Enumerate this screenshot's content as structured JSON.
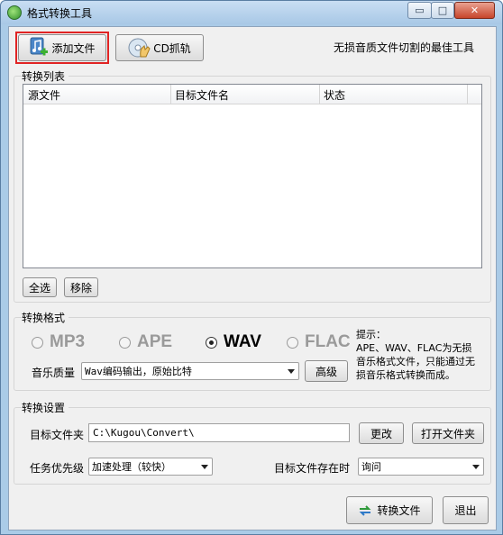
{
  "window": {
    "title": "格式转换工具",
    "controls": {
      "minimize": "▭",
      "maximize": "□",
      "close": "✕"
    }
  },
  "toolbar": {
    "add_file_label": "添加文件",
    "cd_rip_label": "CD抓轨",
    "tagline": "无损音质文件切割的最佳工具"
  },
  "convert_list": {
    "group_label": "转换列表",
    "columns": [
      "源文件",
      "目标文件名",
      "状态"
    ],
    "rows": [],
    "select_all_label": "全选",
    "remove_label": "移除"
  },
  "format": {
    "group_label": "转换格式",
    "options": [
      {
        "label": "MP3",
        "selected": false
      },
      {
        "label": "APE",
        "selected": false
      },
      {
        "label": "WAV",
        "selected": true
      },
      {
        "label": "FLAC",
        "selected": false
      }
    ],
    "quality_label": "音乐质量",
    "quality_value": "Wav编码输出，原始比特",
    "advanced_label": "高级",
    "hint_title": "提示：",
    "hint_text": "APE、WAV、FLAC为无损\n音乐格式文件，只能通过无\n损音乐格式转换而成。"
  },
  "settings": {
    "group_label": "转换设置",
    "target_folder_label": "目标文件夹",
    "target_folder_value": "C:\\Kugou\\Convert\\",
    "change_label": "更改",
    "open_folder_label": "打开文件夹",
    "priority_label": "任务优先级",
    "priority_value": "加速处理（较快）",
    "exists_label": "目标文件存在时",
    "exists_value": "询问"
  },
  "footer": {
    "convert_label": "转换文件",
    "exit_label": "退出"
  },
  "colors": {
    "highlight_box": "#e02424",
    "window_frame": "#aacbe7",
    "client_bg": "#f0f0f0"
  }
}
